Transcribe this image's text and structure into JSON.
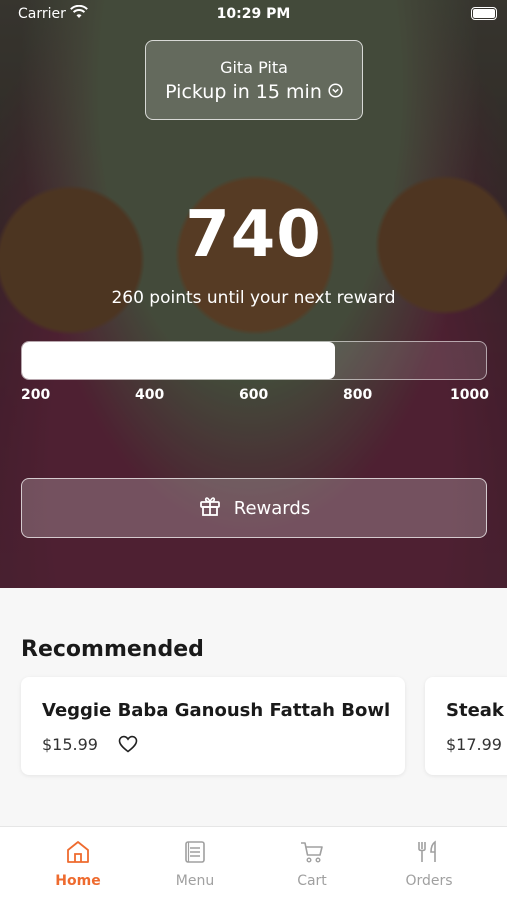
{
  "status_bar": {
    "carrier": "Carrier",
    "time": "10:29 PM"
  },
  "location": {
    "store": "Gita Pita",
    "pickup": "Pickup in 15 min"
  },
  "loyalty": {
    "points": "740",
    "subtitle": "260 points until your next reward",
    "progress": {
      "min": 200,
      "max": 1000,
      "value": 740
    },
    "ticks": [
      "200",
      "400",
      "600",
      "800",
      "1000"
    ]
  },
  "rewards_button": {
    "label": "Rewards"
  },
  "recommended": {
    "title": "Recommended",
    "items": [
      {
        "name": "Veggie Baba Ganoush Fattah Bowl",
        "price": "$15.99"
      },
      {
        "name": "Steak S",
        "price": "$17.99"
      }
    ]
  },
  "tabs": [
    {
      "label": "Home",
      "icon": "home-icon",
      "active": true
    },
    {
      "label": "Menu",
      "icon": "menu-icon",
      "active": false
    },
    {
      "label": "Cart",
      "icon": "cart-icon",
      "active": false
    },
    {
      "label": "Orders",
      "icon": "orders-icon",
      "active": false
    }
  ],
  "colors": {
    "accent": "#ee6b2f",
    "inactive_tab": "#a0a0a0"
  }
}
